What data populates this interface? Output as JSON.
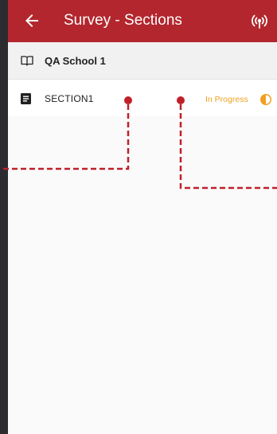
{
  "app_bar": {
    "title": "Survey - Sections",
    "back_icon": "arrow-left-icon",
    "sync_icon": "broadcast-icon",
    "background": "#b3262d"
  },
  "school": {
    "name": "QA School 1",
    "icon": "book-open-icon"
  },
  "sections": [
    {
      "name": "SECTION1",
      "icon": "document-icon",
      "status": "In Progress",
      "status_icon": "half-circle-icon",
      "status_color": "#f0a020"
    }
  ],
  "annotation_color": "#c0202a"
}
